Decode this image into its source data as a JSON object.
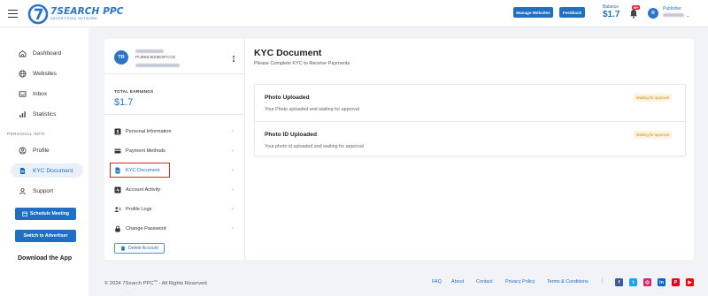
{
  "header": {
    "logo_name": "7SEARCH PPC",
    "logo_sub": "ADVERTISING NETWORK",
    "manage_websites": "Manage Websites",
    "feedback": "Feedback",
    "balance_label": "Balance",
    "balance_value": "$1.7",
    "notif_badge": "99+",
    "avatar_initial": "R",
    "publisher_label": "Publisher"
  },
  "sidebar": {
    "items": [
      {
        "label": "Dashboard",
        "icon": "home-icon"
      },
      {
        "label": "Websites",
        "icon": "globe-icon"
      },
      {
        "label": "Inbox",
        "icon": "inbox-icon"
      },
      {
        "label": "Statistics",
        "icon": "chart-icon"
      }
    ],
    "section_label": "PERSONAL INFO",
    "personal": [
      {
        "label": "Profile",
        "icon": "user-circle-icon"
      },
      {
        "label": "KYC Document",
        "icon": "document-icon",
        "active": true
      },
      {
        "label": "Support",
        "icon": "support-icon"
      }
    ],
    "schedule_meeting": "Schedule Meeting",
    "switch_advertiser": "Switch to Advertiser",
    "download_app": "Download the App"
  },
  "profile": {
    "initials": "TR",
    "pub_id": "PUB6546Z8E5FCCD",
    "total_earnings_label": "TOTAL EARNINGS",
    "total_earnings_value": "$1.7"
  },
  "menu": [
    {
      "label": "Personal Information",
      "icon": "id-card-icon"
    },
    {
      "label": "Payment Methods",
      "icon": "credit-card-icon"
    },
    {
      "label": "KYC Document",
      "icon": "document-icon",
      "active": true
    },
    {
      "label": "Account Activity",
      "icon": "activity-icon"
    },
    {
      "label": "Profile Logs",
      "icon": "users-icon"
    },
    {
      "label": "Change Password",
      "icon": "lock-icon"
    }
  ],
  "delete_account": "Delete Account",
  "kyc": {
    "title": "KYC Document",
    "subtitle": "Please Complete KYC to Receive Payments",
    "docs": [
      {
        "title": "Photo Uploaded",
        "desc": "Your Photo uploaded and waiting for approval",
        "status": "Waiting for approval"
      },
      {
        "title": "Photo ID Uploaded",
        "desc": "Your photo id uploaded and waiting for approval",
        "status": "Waiting for approval"
      }
    ]
  },
  "footer": {
    "copyright": "© 2024 7Search PPC",
    "tm": "TM",
    "rights": " - All Rights Reserved",
    "links": [
      "FAQ",
      "About",
      "Contact",
      "Privacy Policy",
      "Terms & Conditions"
    ],
    "separator": "|",
    "social": [
      {
        "name": "facebook-icon",
        "glyph": "f",
        "color": "#3b5998"
      },
      {
        "name": "twitter-icon",
        "glyph": "t",
        "color": "#1da1f2"
      },
      {
        "name": "instagram-icon",
        "glyph": "◎",
        "color": "#d6246e"
      },
      {
        "name": "linkedin-icon",
        "glyph": "in",
        "color": "#0a66c2"
      },
      {
        "name": "pinterest-icon",
        "glyph": "P",
        "color": "#e60023"
      },
      {
        "name": "youtube-icon",
        "glyph": "▶",
        "color": "#ff0000"
      }
    ]
  }
}
